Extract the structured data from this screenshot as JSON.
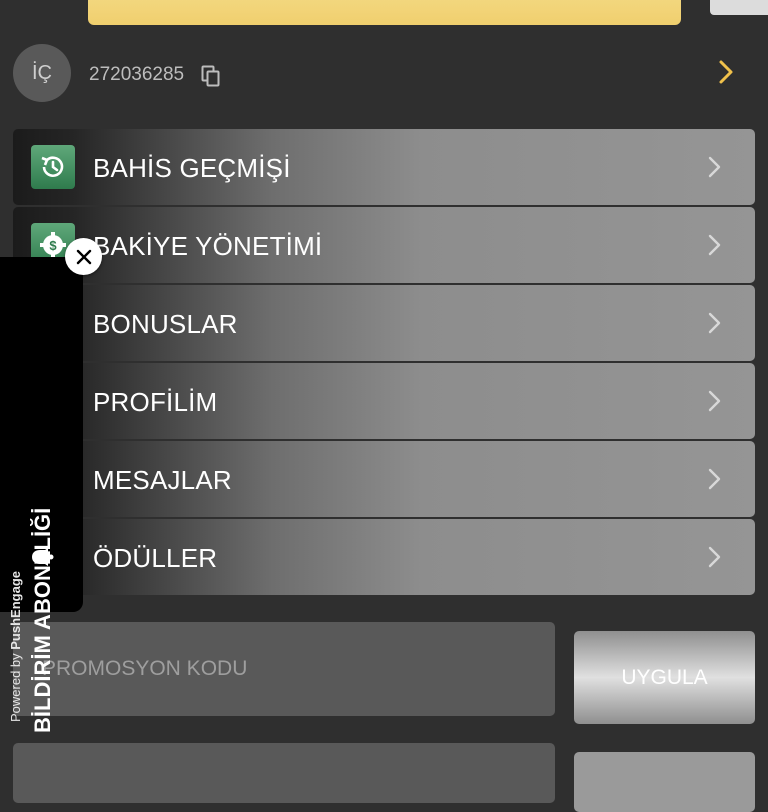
{
  "account": {
    "avatar_initials": "İÇ",
    "user_id": "272036285"
  },
  "menu": {
    "items": [
      {
        "label": "BAHİS GEÇMİŞİ",
        "icon": "history-icon"
      },
      {
        "label": "BAKİYE YÖNETİMİ",
        "icon": "balance-settings-icon"
      },
      {
        "label": "BONUSLAR",
        "icon": "bonus-icon"
      },
      {
        "label": "PROFİLİM",
        "icon": "profile-icon"
      },
      {
        "label": "MESAJLAR",
        "icon": "messages-icon"
      },
      {
        "label": "ÖDÜLLER",
        "icon": "rewards-icon"
      }
    ]
  },
  "promo": {
    "placeholder": "PROMOSYON KODU",
    "apply_label": "UYGULA"
  },
  "push_widget": {
    "powered_by_prefix": "Powered by ",
    "powered_by_brand": "PushEngage",
    "title": "BİLDİRİM ABONELİĞİ"
  },
  "colors": {
    "accent_gold": "#f0cf6e",
    "background": "#2f2f2f",
    "icon_green": "#2f7b4d"
  }
}
